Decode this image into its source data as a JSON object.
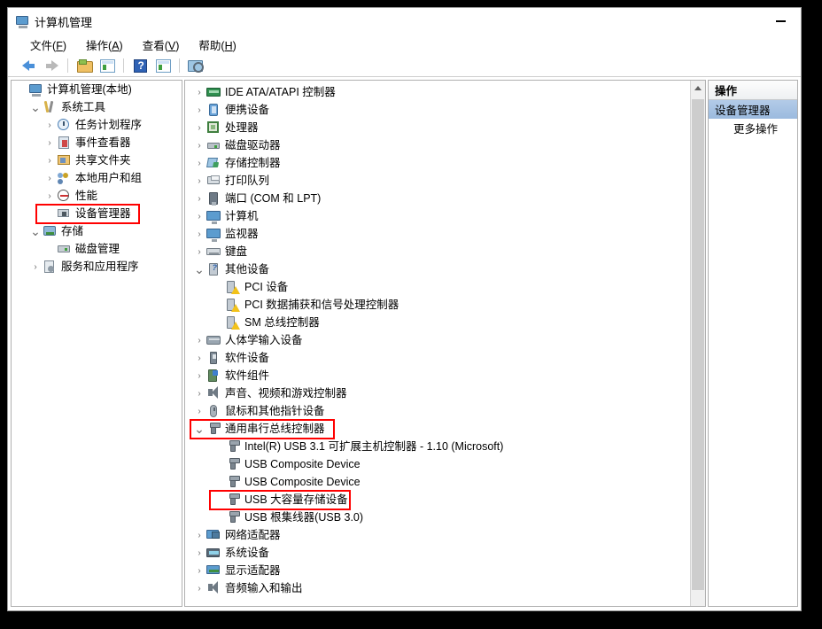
{
  "window": {
    "title": "计算机管理",
    "title_icon": "computer-management-icon",
    "minimize_label": "—"
  },
  "menu": {
    "items": [
      {
        "text": "文件",
        "accel": "F"
      },
      {
        "text": "操作",
        "accel": "A"
      },
      {
        "text": "查看",
        "accel": "V"
      },
      {
        "text": "帮助",
        "accel": "H"
      }
    ]
  },
  "toolbar": {
    "buttons": [
      {
        "icon": "back-arrow-icon"
      },
      {
        "icon": "forward-arrow-icon"
      },
      {
        "icon": "show-hide-tree-icon"
      },
      {
        "icon": "properties-icon"
      },
      {
        "icon": "help-icon"
      },
      {
        "icon": "details-icon"
      },
      {
        "icon": "monitor-scan-icon"
      }
    ]
  },
  "tree": {
    "items": [
      {
        "label": "计算机管理(本地)",
        "icon": "computer-icon",
        "indent": 0,
        "chev": "none",
        "selected": false
      },
      {
        "label": "系统工具",
        "icon": "system-tools-icon",
        "indent": 1,
        "chev": "down",
        "selected": false
      },
      {
        "label": "任务计划程序",
        "icon": "task-scheduler-icon",
        "indent": 2,
        "chev": "right",
        "selected": false
      },
      {
        "label": "事件查看器",
        "icon": "event-viewer-icon",
        "indent": 2,
        "chev": "right",
        "selected": false
      },
      {
        "label": "共享文件夹",
        "icon": "shared-folders-icon",
        "indent": 2,
        "chev": "right",
        "selected": false
      },
      {
        "label": "本地用户和组",
        "icon": "local-users-groups-icon",
        "indent": 2,
        "chev": "right",
        "selected": false
      },
      {
        "label": "性能",
        "icon": "performance-icon",
        "indent": 2,
        "chev": "right",
        "selected": false
      },
      {
        "label": "设备管理器",
        "icon": "device-manager-icon",
        "indent": 2,
        "chev": "none",
        "selected": true
      },
      {
        "label": "存储",
        "icon": "storage-icon",
        "indent": 1,
        "chev": "down",
        "selected": false
      },
      {
        "label": "磁盘管理",
        "icon": "disk-management-icon",
        "indent": 2,
        "chev": "none",
        "selected": false
      },
      {
        "label": "服务和应用程序",
        "icon": "services-applications-icon",
        "indent": 1,
        "chev": "right",
        "selected": false
      }
    ],
    "highlight_index": 7
  },
  "devices": {
    "items": [
      {
        "label": "IDE ATA/ATAPI 控制器",
        "icon": "ide-controller-icon",
        "depth": 0,
        "chev": "right"
      },
      {
        "label": "便携设备",
        "icon": "portable-device-icon",
        "depth": 0,
        "chev": "right"
      },
      {
        "label": "处理器",
        "icon": "processor-icon",
        "depth": 0,
        "chev": "right"
      },
      {
        "label": "磁盘驱动器",
        "icon": "disk-drive-icon",
        "depth": 0,
        "chev": "right"
      },
      {
        "label": "存储控制器",
        "icon": "storage-controller-icon",
        "depth": 0,
        "chev": "right"
      },
      {
        "label": "打印队列",
        "icon": "print-queue-icon",
        "depth": 0,
        "chev": "right"
      },
      {
        "label": "端口 (COM 和 LPT)",
        "icon": "ports-icon",
        "depth": 0,
        "chev": "right"
      },
      {
        "label": "计算机",
        "icon": "computer-node-icon",
        "depth": 0,
        "chev": "right"
      },
      {
        "label": "监视器",
        "icon": "monitor-icon",
        "depth": 0,
        "chev": "right"
      },
      {
        "label": "键盘",
        "icon": "keyboard-icon",
        "depth": 0,
        "chev": "right"
      },
      {
        "label": "其他设备",
        "icon": "other-devices-icon",
        "depth": 0,
        "chev": "down"
      },
      {
        "label": "PCI 设备",
        "icon": "unknown-device-warning-icon",
        "depth": 1,
        "chev": "none"
      },
      {
        "label": "PCI 数据捕获和信号处理控制器",
        "icon": "unknown-device-warning-icon",
        "depth": 1,
        "chev": "none"
      },
      {
        "label": "SM 总线控制器",
        "icon": "unknown-device-warning-icon",
        "depth": 1,
        "chev": "none"
      },
      {
        "label": "人体学输入设备",
        "icon": "hid-icon",
        "depth": 0,
        "chev": "right"
      },
      {
        "label": "软件设备",
        "icon": "software-device-icon",
        "depth": 0,
        "chev": "right"
      },
      {
        "label": "软件组件",
        "icon": "software-component-icon",
        "depth": 0,
        "chev": "right"
      },
      {
        "label": "声音、视频和游戏控制器",
        "icon": "sound-video-game-icon",
        "depth": 0,
        "chev": "right"
      },
      {
        "label": "鼠标和其他指针设备",
        "icon": "mouse-icon",
        "depth": 0,
        "chev": "right"
      },
      {
        "label": "通用串行总线控制器",
        "icon": "usb-controller-icon",
        "depth": 0,
        "chev": "down"
      },
      {
        "label": "Intel(R) USB 3.1 可扩展主机控制器 - 1.10 (Microsoft)",
        "icon": "usb-device-icon",
        "depth": 1,
        "chev": "none"
      },
      {
        "label": "USB Composite Device",
        "icon": "usb-device-icon",
        "depth": 1,
        "chev": "none"
      },
      {
        "label": "USB Composite Device",
        "icon": "usb-device-icon",
        "depth": 1,
        "chev": "none"
      },
      {
        "label": "USB 大容量存储设备",
        "icon": "usb-device-icon",
        "depth": 1,
        "chev": "none"
      },
      {
        "label": "USB 根集线器(USB 3.0)",
        "icon": "usb-device-icon",
        "depth": 1,
        "chev": "none"
      },
      {
        "label": "网络适配器",
        "icon": "network-adapter-icon",
        "depth": 0,
        "chev": "right"
      },
      {
        "label": "系统设备",
        "icon": "system-device-icon",
        "depth": 0,
        "chev": "right"
      },
      {
        "label": "显示适配器",
        "icon": "display-adapter-icon",
        "depth": 0,
        "chev": "right"
      },
      {
        "label": "音频输入和输出",
        "icon": "audio-io-icon",
        "depth": 0,
        "chev": "right"
      }
    ],
    "highlight_indices": [
      19,
      23
    ]
  },
  "actions": {
    "header": "操作",
    "items": [
      {
        "label": "设备管理器",
        "selected": true,
        "sub": false
      },
      {
        "label": "更多操作",
        "selected": false,
        "sub": true
      }
    ]
  },
  "scrollbar": {
    "up_arrow": "caret-up-icon",
    "orientation": "vertical"
  },
  "colors": {
    "annotation_red": "#ff0000",
    "selection_blue": "#9bbade",
    "window_bg": "#ffffff",
    "page_bg": "#000000"
  }
}
